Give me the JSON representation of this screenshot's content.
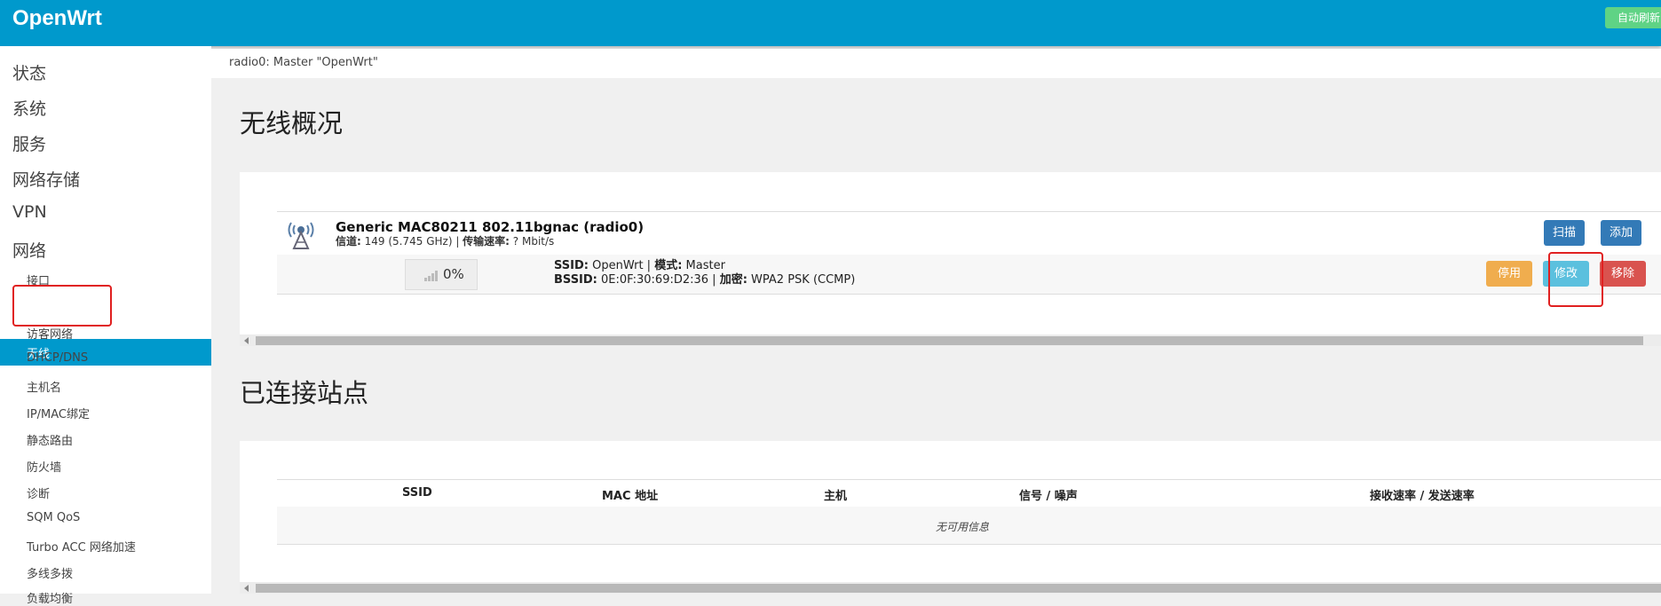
{
  "header": {
    "brand": "OpenWrt",
    "auto_refresh": "自动刷新"
  },
  "sidebar": {
    "top_items": [
      "状态",
      "系统",
      "服务",
      "网络存储",
      "VPN",
      "网络"
    ],
    "sub_items": [
      "接口",
      "无线",
      "访客网络",
      "DHCP/DNS",
      "主机名",
      "IP/MAC绑定",
      "静态路由",
      "防火墙",
      "诊断",
      "SQM QoS",
      "Turbo ACC 网络加速",
      "多线多拨",
      "负载均衡"
    ],
    "active": "无线"
  },
  "breadcrumb": "radio0: Master \"OpenWrt\"",
  "wireless": {
    "title": "无线概况",
    "device": {
      "name": "Generic MAC80211 802.11bgnac (radio0)",
      "channel_label": "信道:",
      "channel_value": " 149 (5.745 GHz) | ",
      "rate_label": "传输速率:",
      "rate_value": " ? Mbit/s",
      "scan_button": "扫描",
      "add_button": "添加"
    },
    "network": {
      "signal": "0%",
      "ssid_label": "SSID:",
      "ssid_value": " OpenWrt | ",
      "mode_label": "模式:",
      "mode_value": " Master",
      "bssid_label": "BSSID:",
      "bssid_value": " 0E:0F:30:69:D2:36 | ",
      "enc_label": "加密:",
      "enc_value": " WPA2 PSK (CCMP)",
      "disable_button": "停用",
      "edit_button": "修改",
      "remove_button": "移除"
    }
  },
  "stations": {
    "title": "已连接站点",
    "columns": [
      "SSID",
      "MAC 地址",
      "主机",
      "信号 / 噪声",
      "接收速率 / 发送速率"
    ],
    "empty_text": "无可用信息"
  },
  "colors": {
    "header": "#0099cc",
    "btn_primary": "#337ab7",
    "btn_warning": "#f0ad4e",
    "btn_info": "#5bc0de",
    "btn_danger": "#d9534f",
    "highlight": "#e02020"
  }
}
